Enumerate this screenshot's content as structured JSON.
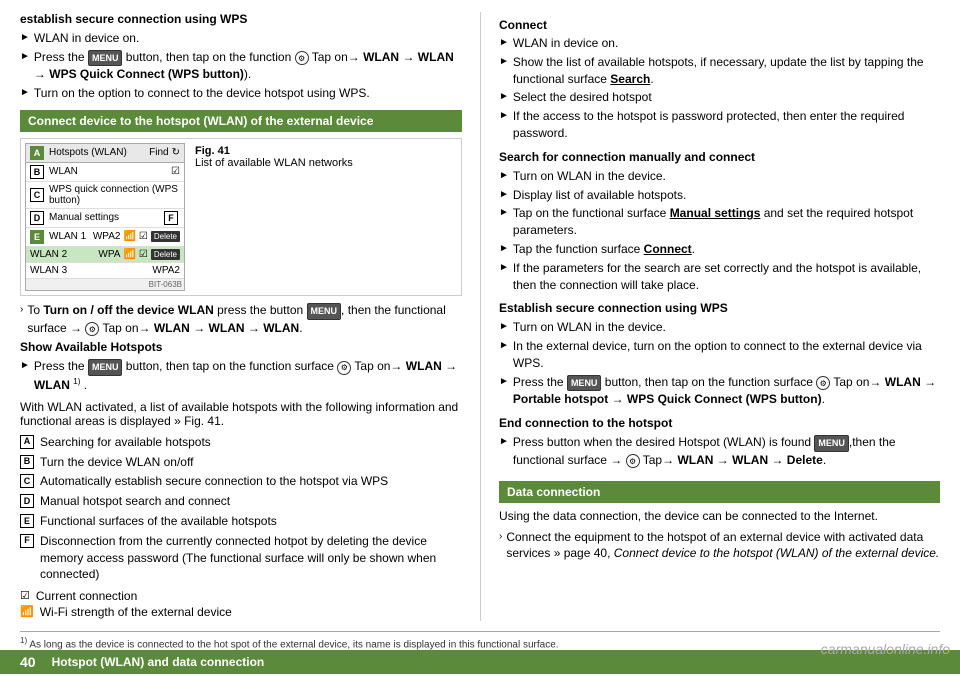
{
  "header": {
    "left_section_heading": "establish secure connection using WPS",
    "wlan_on": "WLAN in device on.",
    "press_menu": "Press the",
    "press_menu2": " button, then tap on the function ",
    "press_menu3": " Tap on→ ",
    "wlan1": "WLAN",
    "arrow1": " → ",
    "wlan2": "WLAN",
    "arrow2": " → ",
    "wps": "WPS Quick Connect (WPS button)",
    "wps_suffix": ").",
    "turn_on_wps": "Turn on the option to connect to the device hotspot using WPS."
  },
  "green_box": {
    "label": "Connect device to the hotspot (WLAN) of the external device"
  },
  "figure": {
    "title": "Fig. 41",
    "subtitle": "List of available WLAN networks"
  },
  "wlan_table": {
    "header_left": "Hotspots (WLAN)",
    "label_a": "A",
    "header_right": "Find",
    "rows": [
      {
        "label": "B",
        "name": "WLAN",
        "label2": ""
      },
      {
        "label": "C",
        "name": "WPS quick connection (WPS button)",
        "label2": ""
      },
      {
        "label": "D",
        "name": "Manual settings",
        "label2": "F"
      },
      {
        "label": "E",
        "name": "WLAN 1",
        "type": "WPA2",
        "wifi": "☑",
        "delete": "Delete"
      },
      {
        "label": "",
        "name": "WLAN 2",
        "type": "WPA",
        "wifi": "☑",
        "delete": "Delete",
        "highlight": true
      },
      {
        "label": "",
        "name": "WLAN 3",
        "type": "WPA2",
        "wifi": "",
        "delete": ""
      }
    ],
    "bit_stamp": "BIT-063B"
  },
  "to_turn": {
    "prefix": "› To ",
    "bold": "Turn on / off the device WLAN",
    "middle": " press the button ",
    "end": ", then the functional surface → ",
    "func": "⚙",
    "arrow": " Tap on→ ",
    "wlan": "WLAN",
    "arr": " → ",
    "wlan2": "WLAN",
    "arr2": " → ",
    "wlan3": "WLAN",
    "period": "."
  },
  "show_hotspots": {
    "heading": "Show Available Hotspots",
    "press_line1": "Press the",
    "press_line2": " button, then tap on the function surface ",
    "press_line3": " Tap on→ ",
    "wlan": "WLAN",
    "arr": " → ",
    "wlan2": "WLAN",
    "sup": "1)",
    "period": "."
  },
  "wlan_activated": "With WLAN activated, a list of available hotspots with the following information and functional areas is displayed » Fig. 41.",
  "desc_items": [
    {
      "label": "A",
      "text": "Searching for available hotspots"
    },
    {
      "label": "B",
      "text": "Turn the device WLAN on/off"
    },
    {
      "label": "C",
      "text": "Automatically establish secure connection to the hotspot via WPS"
    },
    {
      "label": "D",
      "text": "Manual hotspot search and connect"
    },
    {
      "label": "E",
      "text": "Functional surfaces of the available hotspots"
    },
    {
      "label": "F",
      "text": "Disconnection from the currently connected hotpot by deleting the device memory access password (The functional surface will only be shown when connected)"
    }
  ],
  "checkmarks": [
    {
      "icon": "☑",
      "text": "Current connection"
    },
    {
      "icon": "📶",
      "text": "Wi-Fi strength of the external device"
    }
  ],
  "right_col": {
    "connect_heading": "Connect",
    "connect_items": [
      "WLAN in device on.",
      "Show the list of available hotspots, if necessary, update the list by tapping the functional surface Search.",
      "Select the desired hotspot",
      "If the access to the hotspot is password protected, then enter the required password."
    ],
    "search_heading": "Search for connection manually and connect",
    "search_items": [
      "Turn on WLAN in the device.",
      "Display list of available hotspots.",
      "Tap on the functional surface Manual settings and set the required hotspot parameters.",
      "Tap the function surface Connect.",
      "If the parameters for the search are set correctly and the hotspot is available, then the connection will take place."
    ],
    "wps_heading": "Establish secure connection using WPS",
    "wps_items": [
      "Turn on WLAN in the device.",
      "In the external device, turn on the option to connect to the external device via WPS.",
      "Press the  button, then tap on the function surface  Tap on→ WLAN → Portable hotspot → WPS Quick Connect (WPS button)."
    ],
    "end_heading": "End connection to the hotspot",
    "end_items": [
      "Press button when the desired Hotspot (WLAN) is found ,then the functional surface → ⚙ Tap→ WLAN → WLAN → Delete."
    ],
    "data_heading": "Data connection",
    "data_box": "Data connection",
    "data_text": "Using the data connection, the device can be connected to the Internet.",
    "connect_equip": "Connect the equipment to the hotspot of an external device with activated data services » page 40, Connect device to the hotspot (WLAN) of the exter­nal device."
  },
  "footnote": {
    "sup": "1)",
    "text": "As long as the device is connected to the hot spot of the external device, its name is displayed in this functional surface."
  },
  "footer": {
    "page_num": "40",
    "label": "Hotspot (WLAN) and data connection"
  },
  "watermark": "carmanualonline.info"
}
